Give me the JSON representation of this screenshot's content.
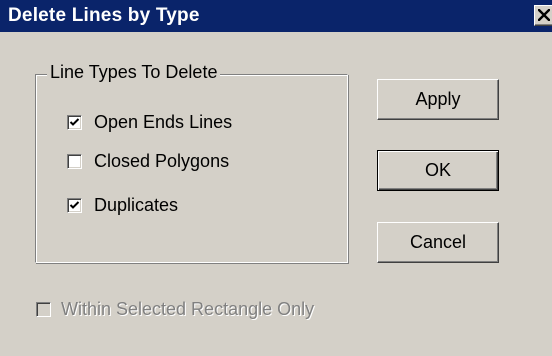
{
  "window": {
    "title": "Delete Lines by Type",
    "close_glyph": "✖",
    "colors": {
      "titlebar": "#0a246a",
      "face": "#d4d0c8",
      "disabled_text": "#808080"
    }
  },
  "group": {
    "label": "Line Types To Delete",
    "options": [
      {
        "label": "Open Ends Lines",
        "checked": true
      },
      {
        "label": "Closed Polygons",
        "checked": false
      },
      {
        "label": "Duplicates",
        "checked": true
      }
    ]
  },
  "buttons": {
    "apply": "Apply",
    "ok": "OK",
    "cancel": "Cancel"
  },
  "within_rect": {
    "label": "Within Selected Rectangle Only",
    "checked": false,
    "enabled": false
  }
}
